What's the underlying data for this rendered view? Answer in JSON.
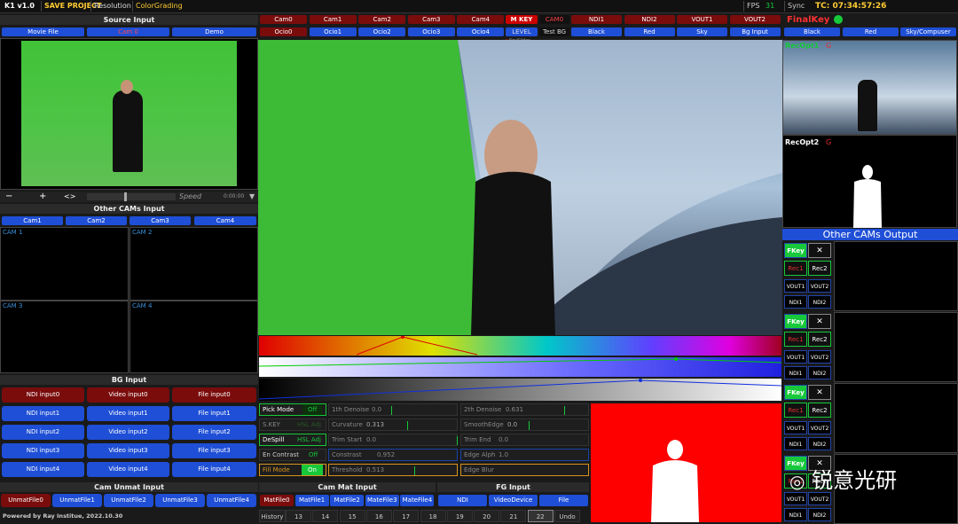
{
  "topbar": {
    "app": "K1 v1.0",
    "save": "SAVE PROJECT",
    "resolution": "Resolution",
    "grading": "ColorGrading",
    "fps_label": "FPS",
    "fps": "31",
    "sync": "Sync",
    "tc": "TC: 07:34:57:26"
  },
  "source": {
    "title": "Source Input",
    "tabs": [
      "Movie File",
      "Cam 0",
      "Demo"
    ],
    "speed": "Speed",
    "time": "0:00:00",
    "minus": "−",
    "plus": "+",
    "arrows": "<>"
  },
  "other_cams": {
    "title": "Other CAMs Input",
    "tabs": [
      "Cam1",
      "Cam2",
      "Cam3",
      "Cam4"
    ],
    "labels": [
      "CAM 1",
      "CAM 2",
      "CAM 3",
      "CAM 4"
    ]
  },
  "bg": {
    "title": "BG Input",
    "rows": [
      [
        "NDI input0",
        "Video input0",
        "File input0"
      ],
      [
        "NDI input1",
        "Video input1",
        "File input1"
      ],
      [
        "NDI input2",
        "Video input2",
        "File input2"
      ],
      [
        "NDI input3",
        "Video input3",
        "File input3"
      ],
      [
        "NDI input4",
        "Video input4",
        "File input4"
      ]
    ]
  },
  "unmat": {
    "title": "Cam Unmat Input",
    "items": [
      "UnmatFile0",
      "UnmatFile1",
      "UnmatFile2",
      "UnmatFile3",
      "UnmatFile4"
    ]
  },
  "footer": "Powered by Ray Institue, 2022.10.30",
  "cams_row1": [
    "Cam0",
    "Cam1",
    "Cam2",
    "Cam3",
    "Cam4"
  ],
  "ocio_row": [
    "Ocio0",
    "Ocio1",
    "Ocio2",
    "Ocio3",
    "Ocio4"
  ],
  "mkey": "M KEY",
  "level": "LEVEL",
  "keyslider": "KeySlider",
  "cam0": "CAM0",
  "testbg": "Test BG",
  "out_row1": [
    "NDI1",
    "NDI2",
    "VOUT1",
    "VOUT2"
  ],
  "out_row2": [
    "Black",
    "Red",
    "Sky",
    "Bg Input"
  ],
  "final": {
    "title": "FinalKey",
    "tabs": [
      "Black",
      "Red",
      "Sky/Compuser"
    ],
    "rec1": "RecOpt1",
    "rec2": "RecOpt2",
    "g": "G"
  },
  "controls": {
    "pick": "Pick Mode",
    "pick_v": "Off",
    "skey": "S.KEY",
    "skey_v": "HSL Adj",
    "despill": "DeSpill",
    "despill_v": "HSL Adj",
    "encontrast": "En Contrast",
    "encontrast_v": "Off",
    "fill": "Fill Mode",
    "fill_v": "On",
    "denoise": "1th Denoise",
    "denoise_v": "0.0",
    "curv": "Curvature",
    "curv_v": "0.313",
    "trims": "Trim Start",
    "trims_v": "0.0",
    "contrast": "Constrast",
    "contrast_v": "0.952",
    "thresh": "Threshold",
    "thresh_v": "0.513",
    "denoise2": "2th Denoise",
    "denoise2_v": "0.631",
    "smooth": "SmoothEdge",
    "smooth_v": "0.0",
    "trime": "Trim End",
    "trime_v": "0.0",
    "alpha": "Edge Alph",
    "alpha_v": "1.0",
    "blur": "Edge Blur",
    "blur_v": ""
  },
  "cammat": {
    "title": "Cam Mat Input",
    "items": [
      "MatFile0",
      "MatFile1",
      "MatFile2",
      "MateFile3",
      "MateFile4"
    ]
  },
  "fg": {
    "title": "FG Input",
    "items": [
      "NDI",
      "VideoDevice",
      "File"
    ]
  },
  "history": [
    "History",
    "13",
    "14",
    "15",
    "16",
    "17",
    "18",
    "19",
    "20",
    "21",
    "22",
    "Undo"
  ],
  "other_out": {
    "title": "Other CAMs Output",
    "fkey": "FKey",
    "x": "✕",
    "rec1": "Rec1",
    "rec2": "Rec2",
    "vout1": "VOUT1",
    "vout2": "VOUT2",
    "ndi1": "NDI1",
    "ndi2": "NDI2"
  },
  "watermark": "锐意光研",
  "colors": {
    "accent_green": "#17c93a",
    "button_blue": "#1f4fd6",
    "dark_red": "#7a0c0c",
    "key_red": "#ff0000"
  }
}
